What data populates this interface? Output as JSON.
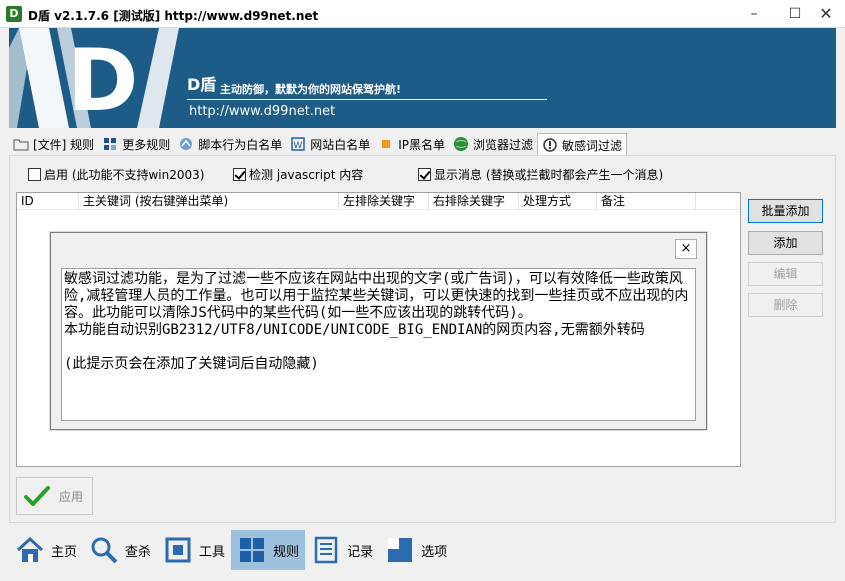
{
  "window": {
    "title": "D盾 v2.1.7.6 [测试版] http://www.d99net.net",
    "icon": "d-shield-app-icon",
    "minimize": "–",
    "maximize": "☐",
    "close": "✕"
  },
  "banner": {
    "brand": "D盾",
    "slogan": "主动防御，默默为你的网站保驾护航!",
    "url": "http://www.d99net.net",
    "color": "#1c5c86"
  },
  "tabs": [
    {
      "label": "[文件] 规则",
      "icon": "folder-icon"
    },
    {
      "label": "更多规则",
      "icon": "rules-icon"
    },
    {
      "label": "脚本行为白名单",
      "icon": "script-icon"
    },
    {
      "label": "网站白名单",
      "icon": "website-icon"
    },
    {
      "label": "IP黑名单",
      "icon": "ip-block-icon"
    },
    {
      "label": "浏览器过滤",
      "icon": "browser-globe-icon"
    },
    {
      "label": "敏感词过滤",
      "icon": "sensitive-word-icon",
      "active": true
    }
  ],
  "options": {
    "enable": {
      "label": "启用 (此功能不支持win2003)",
      "checked": false
    },
    "detect_js": {
      "label": "检测 javascript 内容",
      "checked": true
    },
    "show_message": {
      "label": "显示消息 (替换或拦截时都会产生一个消息)",
      "checked": true
    }
  },
  "table": {
    "columns": [
      "ID",
      "主关键词 (按右键弹出菜单)",
      "左排除关键字",
      "右排除关键字",
      "处理方式",
      "备注"
    ],
    "rows": []
  },
  "side_buttons": {
    "batch_add": "批量添加",
    "add": "添加",
    "edit": "编辑",
    "delete": "删除"
  },
  "help_dialog": {
    "close": "×",
    "line1": "敏感词过滤功能，是为了过滤一些不应该在网站中出现的文字(或广告词)，可以有效降低一些政策风险,减轻管理人员的工作量。也可以用于监控某些关键词，可以更快速的找到一些挂页或不应出现的内容。此功能可以清除JS代码中的某些代码(如一些不应该出现的跳转代码)。",
    "line2": "本功能自动识别GB2312/UTF8/UNICODE/UNICODE_BIG_ENDIAN的网页内容,无需额外转码",
    "line3": "(此提示页会在添加了关键词后自动隐藏)"
  },
  "apply_button": {
    "label": "应用",
    "icon": "checkmark-icon"
  },
  "bottom_nav": [
    {
      "label": "主页",
      "icon": "home-icon"
    },
    {
      "label": "查杀",
      "icon": "magnifier-icon"
    },
    {
      "label": "工具",
      "icon": "tools-icon"
    },
    {
      "label": "规则",
      "icon": "grid-rules-icon",
      "active": true
    },
    {
      "label": "记录",
      "icon": "log-icon"
    },
    {
      "label": "选项",
      "icon": "options-icon"
    }
  ]
}
